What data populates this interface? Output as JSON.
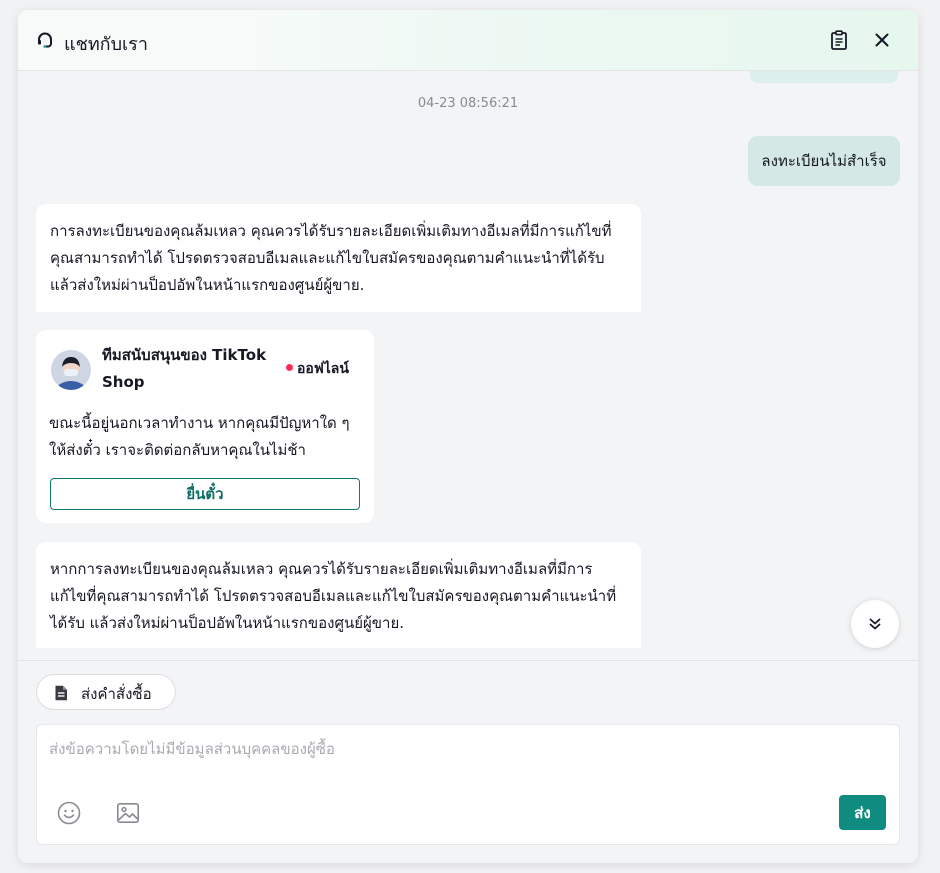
{
  "header": {
    "title": "แชทกับเรา",
    "icons": {
      "support": "headset-icon",
      "orders": "clipboard-icon",
      "close": "close-icon"
    }
  },
  "chat": {
    "timestamp": "04-23 08:56:21",
    "user_message": "ลงทะเบียนไม่สำเร็จ",
    "bot_message_1": "การลงทะเบียนของคุณล้มเหลว คุณควรได้รับรายละเอียดเพิ่มเติมทางอีเมลที่มีการแก้ไขที่คุณสามารถทำได้ โปรดตรวจสอบอีเมลและแก้ไขใบสมัครของคุณตามคำแนะนำที่ได้รับ แล้วส่งใหม่ผ่านป็อปอัพในหน้าแรกของศูนย์ผู้ขาย.",
    "agent_card": {
      "name": "ทีมสนับสนุนของ TikTok Shop",
      "status": "ออฟไลน์",
      "status_color": "#fe2c55",
      "message": "ขณะนี้อยู่นอกเวลาทำงาน หากคุณมีปัญหาใด ๆ ให้ส่งตั๋ว เราจะติดต่อกลับหาคุณในไม่ช้า",
      "button_label": "ยื่นตั๋ว"
    },
    "bot_message_2": "หากการลงทะเบียนของคุณล้มเหลว คุณควรได้รับรายละเอียดเพิ่มเติมทางอีเมลที่มีการแก้ไขที่คุณสามารถทำได้ โปรดตรวจสอบอีเมลและแก้ไขใบสมัครของคุณตามคำแนะนำที่ได้รับ แล้วส่งใหม่ผ่านป็อปอัพในหน้าแรกของศูนย์ผู้ขาย."
  },
  "footer": {
    "order_button": "ส่งคำสั่งซื้อ",
    "input_placeholder": "ส่งข้อความโดยไม่มีข้อมูลส่วนบุคคลของผู้ซื้อ",
    "send_label": "ส่ง",
    "accent_color": "#0f8b80"
  }
}
